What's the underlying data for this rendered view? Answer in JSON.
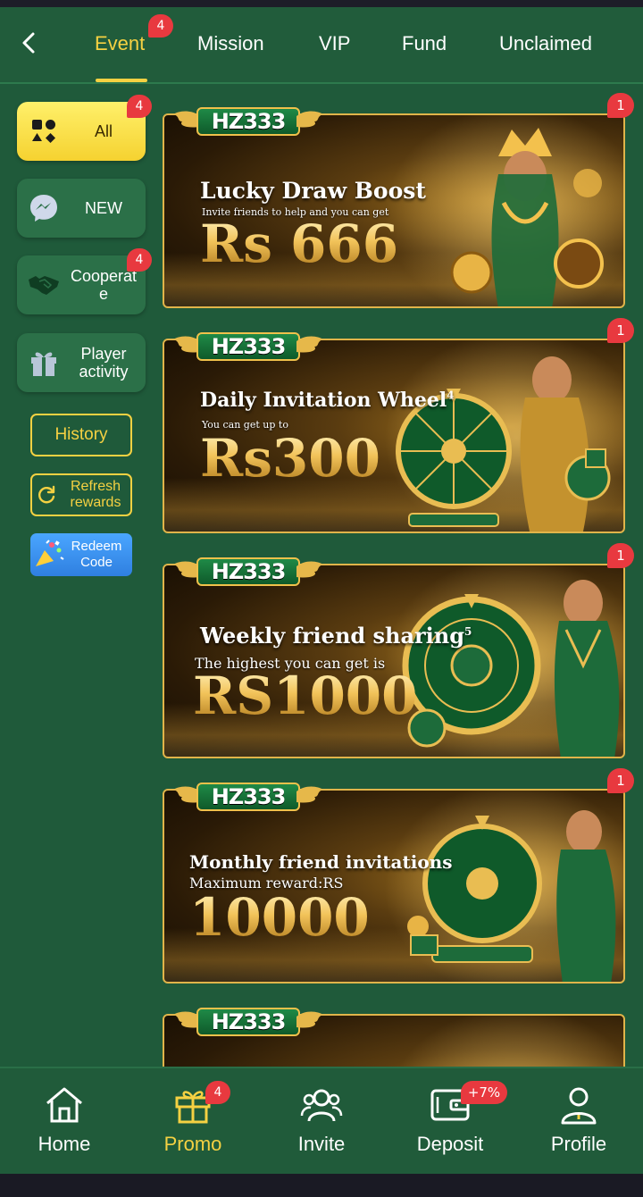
{
  "topnav": {
    "tabs": [
      {
        "label": "Event",
        "active": true,
        "badge": "4"
      },
      {
        "label": "Mission"
      },
      {
        "label": "VIP"
      },
      {
        "label": "Fund"
      },
      {
        "label": "Unclaimed"
      }
    ]
  },
  "sidebar": {
    "items": [
      {
        "label": "All",
        "badge": "4",
        "icon": "category-grid-icon",
        "active": true
      },
      {
        "label": "NEW",
        "icon": "messenger-icon"
      },
      {
        "label": "Cooperate",
        "badge": "4",
        "icon": "handshake-icon"
      },
      {
        "label": "Player activity",
        "icon": "gift-icon"
      }
    ],
    "history_label": "History",
    "refresh_label": "Refresh rewards",
    "redeem_label": "Redeem Code"
  },
  "banners": [
    {
      "logo": "HZ333",
      "badge": "1",
      "title": "Lucky Draw Boost",
      "subtitle": "Invite friends to help and you can get",
      "amount": "Rs 666"
    },
    {
      "logo": "HZ333",
      "badge": "1",
      "title": "Daily Invitation Wheel",
      "title_mark": "4",
      "subtitle": "You can get up to",
      "amount": "Rs300"
    },
    {
      "logo": "HZ333",
      "badge": "1",
      "title": "Weekly friend sharing",
      "title_mark": "5",
      "subtitle": "The highest you can get is",
      "amount": "RS1000"
    },
    {
      "logo": "HZ333",
      "badge": "1",
      "title": "Monthly friend invitations",
      "subtitle": "Maximum reward:RS",
      "amount": "10000"
    },
    {
      "logo": "HZ333"
    }
  ],
  "bottomnav": {
    "items": [
      {
        "label": "Home",
        "icon": "home-icon"
      },
      {
        "label": "Promo",
        "icon": "gift-box-icon",
        "active": true,
        "badge": "4"
      },
      {
        "label": "Invite",
        "icon": "users-icon"
      },
      {
        "label": "Deposit",
        "icon": "wallet-icon",
        "badge": "+7%"
      },
      {
        "label": "Profile",
        "icon": "profile-icon"
      }
    ]
  },
  "colors": {
    "background": "#1f5a3a",
    "accent": "#f5d142",
    "badge": "#e8393f",
    "banner_border": "#e0b44a"
  }
}
